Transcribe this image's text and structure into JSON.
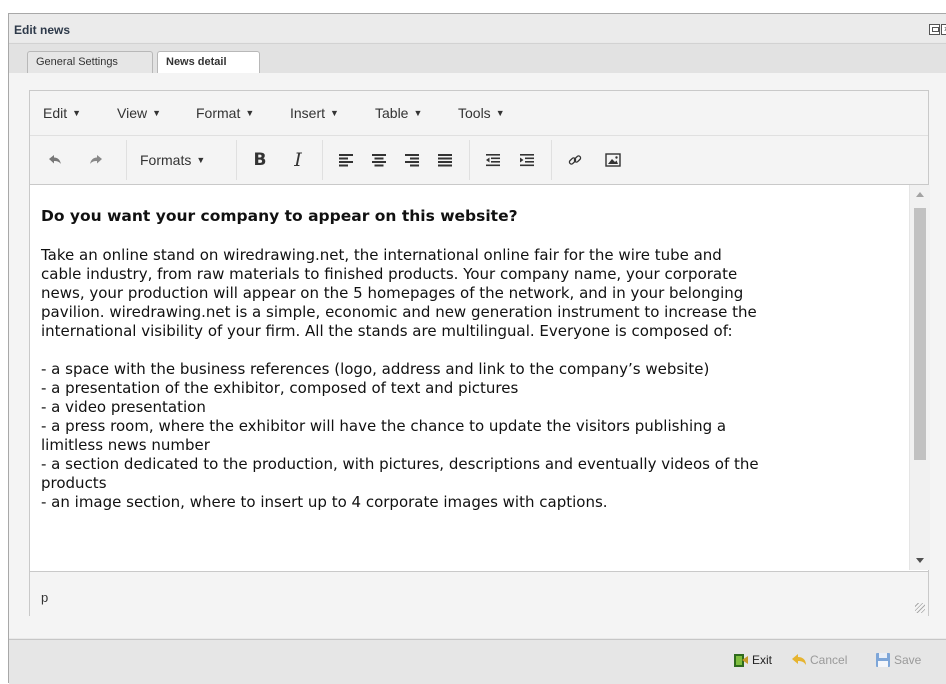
{
  "window": {
    "title": "Edit news"
  },
  "tabs": [
    {
      "label": "General Settings",
      "active": false
    },
    {
      "label": "News detail",
      "active": true
    }
  ],
  "menubar": [
    "Edit",
    "View",
    "Format",
    "Insert",
    "Table",
    "Tools"
  ],
  "toolbar": {
    "formats_label": "Formats",
    "buttons": [
      "undo-icon",
      "redo-icon",
      "bold-icon",
      "italic-icon",
      "align-left-icon",
      "align-center-icon",
      "align-right-icon",
      "align-justify-icon",
      "outdent-icon",
      "indent-icon",
      "link-icon",
      "image-icon"
    ]
  },
  "content": {
    "heading": "Do you want your company to appear on this website?",
    "paragraph_lines": [
      "Take an online stand on wiredrawing.net, the international online fair for the wire tube and",
      "cable industry, from raw materials to finished products. Your company name, your corporate",
      "news, your production will appear on the 5 homepages of the network, and in your belonging",
      "pavilion. wiredrawing.net is a simple, economic and new generation instrument to increase the",
      "international visibility of your firm. All the stands are multilingual. Everyone is composed of:"
    ],
    "list_lines": [
      "- a space with the business references (logo, address and link to the company’s website)",
      "- a presentation of the exhibitor, composed of text and pictures",
      "- a video presentation",
      "- a press room, where the exhibitor will have the chance to update the visitors publishing a",
      "limitless news number",
      "- a section dedicated to the production, with pictures, descriptions and eventually videos of the",
      "products",
      "- an image section, where to insert up to 4 corporate images with captions."
    ]
  },
  "statusbar": {
    "path": "p"
  },
  "footer": {
    "exit": "Exit",
    "cancel": "Cancel",
    "save": "Save"
  }
}
